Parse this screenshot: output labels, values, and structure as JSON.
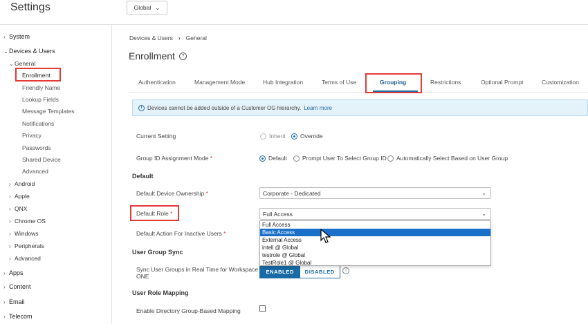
{
  "app": {
    "title": "Settings",
    "og_selector": "Global"
  },
  "sidebar": {
    "items": [
      {
        "label": "System",
        "level": 0
      },
      {
        "label": "Devices & Users",
        "level": 0
      },
      {
        "label": "General",
        "level": 1
      },
      {
        "label": "Enrollment",
        "level": 2
      },
      {
        "label": "Friendly Name",
        "level": 2
      },
      {
        "label": "Lookup Fields",
        "level": 2
      },
      {
        "label": "Message Templates",
        "level": 2
      },
      {
        "label": "Notifications",
        "level": 2
      },
      {
        "label": "Privacy",
        "level": 2
      },
      {
        "label": "Passwords",
        "level": 2
      },
      {
        "label": "Shared Device",
        "level": 2
      },
      {
        "label": "Advanced",
        "level": 2
      },
      {
        "label": "Android",
        "level": 1
      },
      {
        "label": "Apple",
        "level": 1
      },
      {
        "label": "QNX",
        "level": 1
      },
      {
        "label": "Chrome OS",
        "level": 1
      },
      {
        "label": "Windows",
        "level": 1
      },
      {
        "label": "Peripherals",
        "level": 1
      },
      {
        "label": "Advanced",
        "level": 1
      },
      {
        "label": "Apps",
        "level": 0
      },
      {
        "label": "Content",
        "level": 0
      },
      {
        "label": "Email",
        "level": 0
      },
      {
        "label": "Telecom",
        "level": 0
      }
    ]
  },
  "breadcrumb": {
    "parent": "Devices & Users",
    "current": "General"
  },
  "page": {
    "title": "Enrollment"
  },
  "tabs": [
    {
      "label": "Authentication"
    },
    {
      "label": "Management Mode"
    },
    {
      "label": "Hub Integration"
    },
    {
      "label": "Terms of Use"
    },
    {
      "label": "Grouping"
    },
    {
      "label": "Restrictions"
    },
    {
      "label": "Optional Prompt"
    },
    {
      "label": "Customization"
    }
  ],
  "banner": {
    "text": "Devices cannot be added outside of a Customer OG hierarchy.",
    "link": "Learn more"
  },
  "form": {
    "current_setting": {
      "label": "Current Setting",
      "options": [
        "Inherit",
        "Override"
      ],
      "selected": "Override"
    },
    "group_id_mode": {
      "label": "Group ID Assignment Mode",
      "options": [
        "Default",
        "Prompt User To Select Group ID",
        "Automatically Select Based on User Group"
      ],
      "selected": "Default"
    },
    "section_default": "Default",
    "device_ownership": {
      "label": "Default Device Ownership",
      "value": "Corporate - Dedicated"
    },
    "default_role": {
      "label": "Default Role",
      "value": "Full Access",
      "options": [
        "Full Access",
        "Basic Access",
        "External Access",
        "intell @ Global",
        "testrole @ Global",
        "TestRole1 @ Global"
      ],
      "highlighted": "Basic Access"
    },
    "inactive_users": {
      "label": "Default Action For Inactive Users"
    },
    "section_user_group_sync": "User Group Sync",
    "sync_groups": {
      "label_line1": "Sync User Groups in Real Time for Workspace",
      "label_line2": "ONE",
      "on_label": "ENABLED",
      "off_label": "DISABLED",
      "state": "ENABLED"
    },
    "section_user_role_mapping": "User Role Mapping",
    "directory_mapping": {
      "label": "Enable Directory Group-Based Mapping",
      "checked": false
    }
  },
  "required_marker": "*",
  "colors": {
    "accent": "#1a6aa6",
    "highlight_box": "#e53935",
    "selected_option": "#1a70c8"
  }
}
